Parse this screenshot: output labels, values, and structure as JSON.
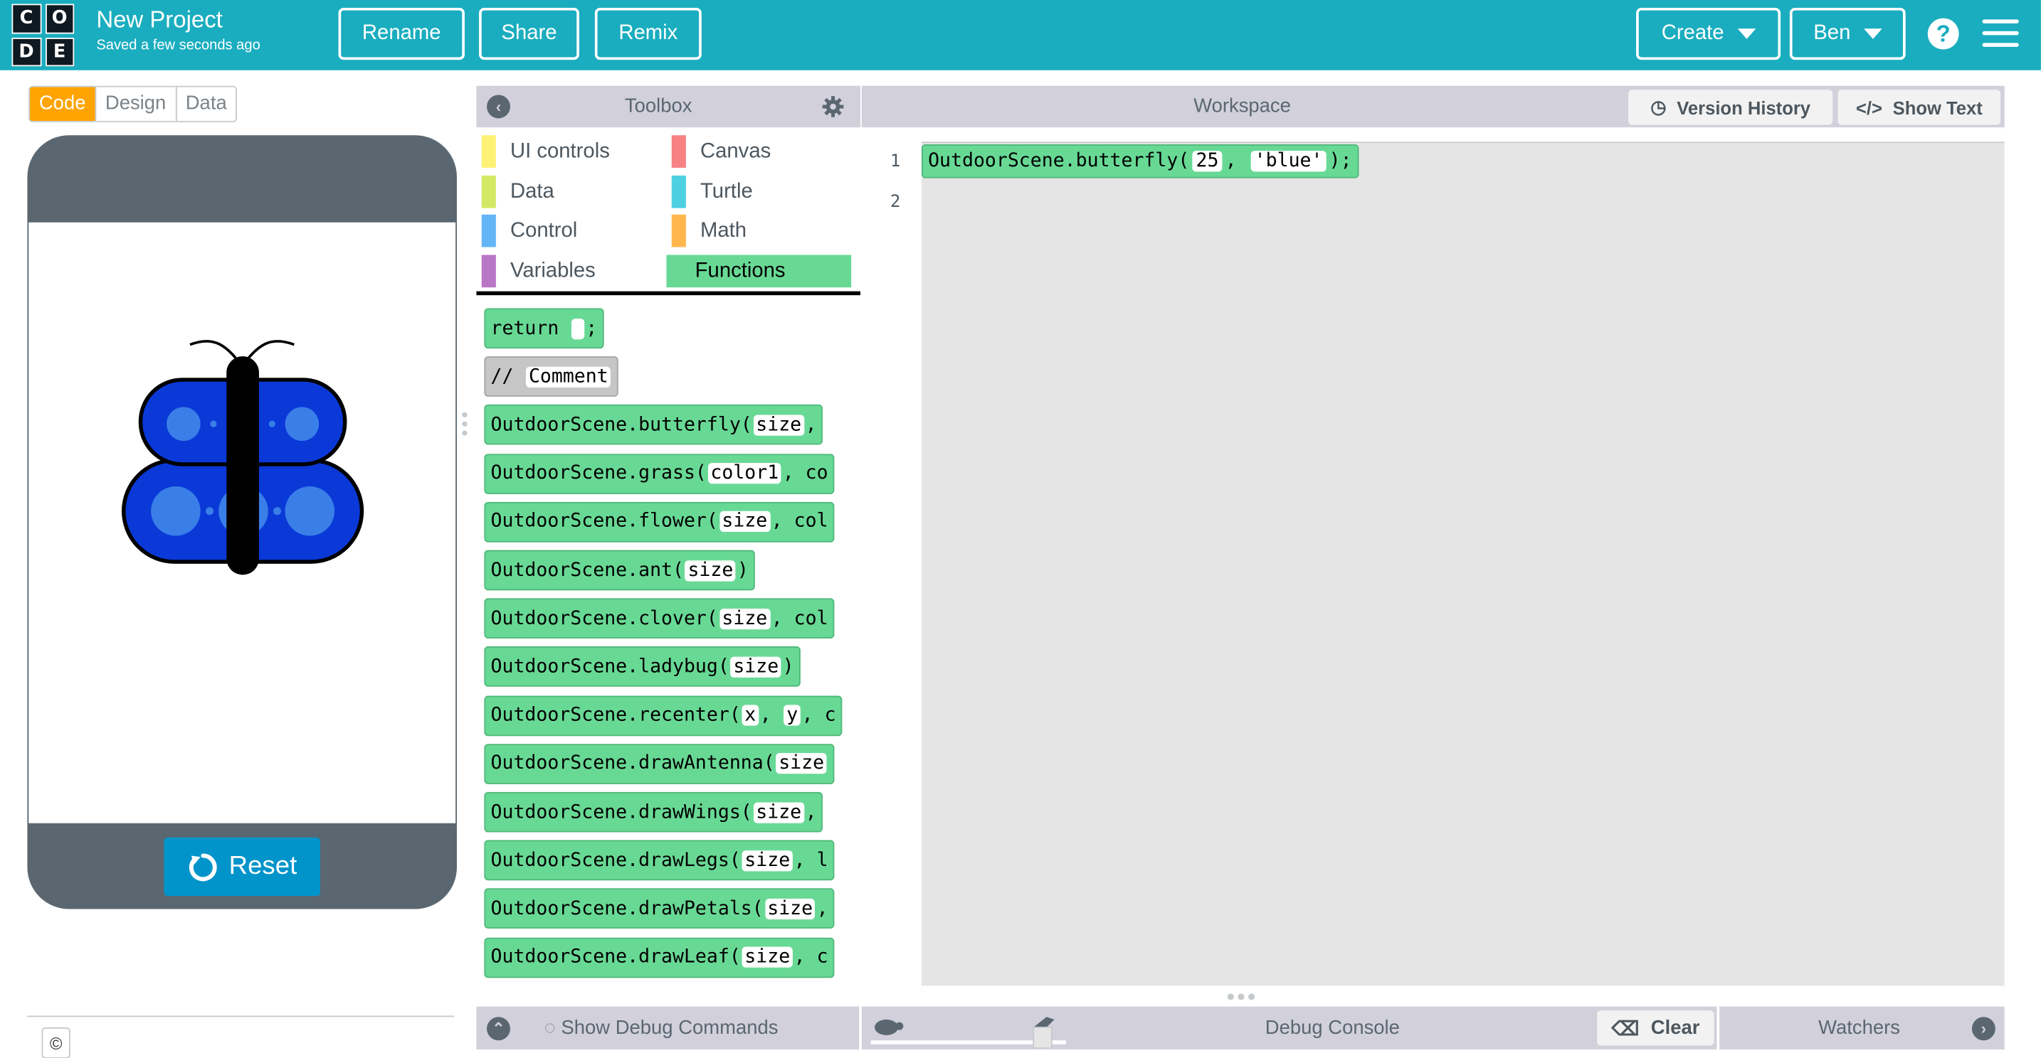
{
  "header": {
    "logo_letters": [
      "C",
      "O",
      "D",
      "E"
    ],
    "project_title": "New Project",
    "save_status": "Saved a few seconds ago",
    "rename_label": "Rename",
    "share_label": "Share",
    "remix_label": "Remix",
    "create_label": "Create",
    "user_label": "Ben",
    "help_icon": "?",
    "brand_color": "#1aadbf"
  },
  "modes": {
    "code": "Code",
    "design": "Design",
    "data": "Data",
    "active": "Code"
  },
  "app": {
    "reset_label": "Reset"
  },
  "footer": {
    "copyright_symbol": "©"
  },
  "toolbox": {
    "title": "Toolbox",
    "categories": [
      {
        "label": "UI controls",
        "color": "#fff176"
      },
      {
        "label": "Canvas",
        "color": "#f78183"
      },
      {
        "label": "Data",
        "color": "#d3e965"
      },
      {
        "label": "Turtle",
        "color": "#4dd0e1"
      },
      {
        "label": "Control",
        "color": "#64b5f6"
      },
      {
        "label": "Math",
        "color": "#ffb74d"
      },
      {
        "label": "Variables",
        "color": "#bb77c7"
      },
      {
        "label": "Functions",
        "color": "#68d995"
      }
    ],
    "selected_category": "Functions",
    "blocks": [
      {
        "prefix": "return ",
        "slots": [
          ""
        ],
        "suffix": ";"
      },
      {
        "prefix": "// ",
        "slots": [
          "Comment"
        ],
        "suffix": ""
      },
      {
        "prefix": "OutdoorScene.butterfly(",
        "slots": [
          "size"
        ],
        "suffix": ","
      },
      {
        "prefix": "OutdoorScene.grass(",
        "slots": [
          "color1"
        ],
        "suffix": ", co"
      },
      {
        "prefix": "OutdoorScene.flower(",
        "slots": [
          "size"
        ],
        "suffix": ", col"
      },
      {
        "prefix": "OutdoorScene.ant(",
        "slots": [
          "size"
        ],
        "suffix": ")"
      },
      {
        "prefix": "OutdoorScene.clover(",
        "slots": [
          "size"
        ],
        "suffix": ", col"
      },
      {
        "prefix": "OutdoorScene.ladybug(",
        "slots": [
          "size"
        ],
        "suffix": ")"
      },
      {
        "prefix": "OutdoorScene.recenter(",
        "slots": [
          "x",
          "y"
        ],
        "suffix": ", c"
      },
      {
        "prefix": "OutdoorScene.drawAntenna(",
        "slots": [
          "size"
        ],
        "suffix": ""
      },
      {
        "prefix": "OutdoorScene.drawWings(",
        "slots": [
          "size"
        ],
        "suffix": ","
      },
      {
        "prefix": "OutdoorScene.drawLegs(",
        "slots": [
          "size"
        ],
        "suffix": ", l"
      },
      {
        "prefix": "OutdoorScene.drawPetals(",
        "slots": [
          "size"
        ],
        "suffix": ","
      },
      {
        "prefix": "OutdoorScene.drawLeaf(",
        "slots": [
          "size"
        ],
        "suffix": ", c"
      }
    ]
  },
  "workspace": {
    "title": "Workspace",
    "version_history_label": "Version History",
    "show_text_label": "Show Text",
    "line_numbers": [
      "1",
      "2"
    ],
    "code_line": {
      "prefix": "OutdoorScene.butterfly(",
      "arg1": "25",
      "sep": ", ",
      "arg2": "'blue'",
      "suffix": ");"
    }
  },
  "debug": {
    "show_commands_label": "Show Debug Commands",
    "console_title": "Debug Console",
    "clear_label": "Clear",
    "watchers_label": "Watchers"
  },
  "colors": {
    "block_green": "#68d995",
    "header_gray": "#d1d0db",
    "phone_frame": "#5b6770",
    "reset_blue": "#0094ca",
    "mode_active": "#ffa400"
  }
}
